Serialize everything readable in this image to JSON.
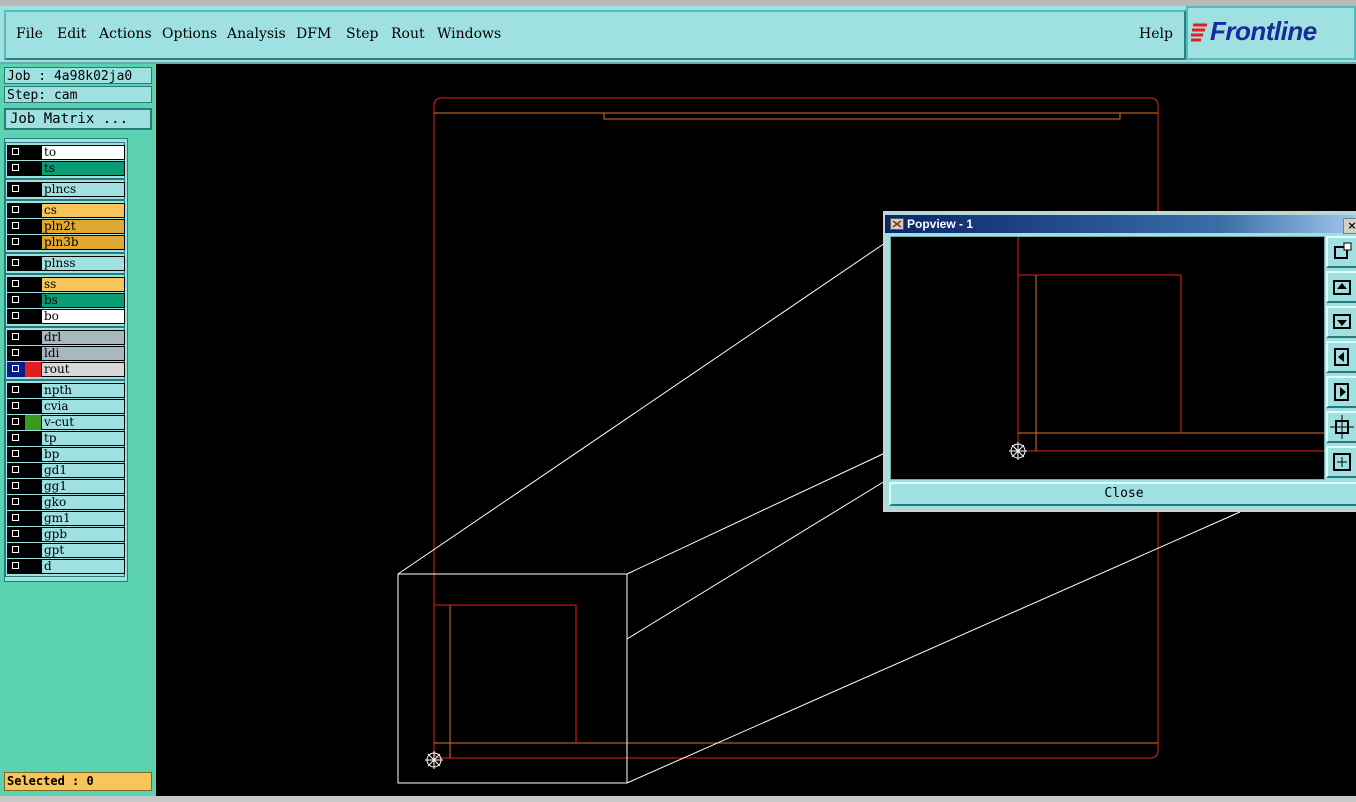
{
  "menubar": {
    "items": [
      "File",
      "Edit",
      "Actions",
      "Options",
      "Analysis",
      "DFM",
      "Step",
      "Rout",
      "Windows"
    ],
    "help": "Help",
    "logo": "Frontline"
  },
  "sidebar": {
    "job": "Job : 4a98k02ja0",
    "step": "Step: cam",
    "job_matrix_button": "Job Matrix ...",
    "layers": [
      {
        "name": "to",
        "color": "#ffffff"
      },
      {
        "name": "ts",
        "color": "#0c9c74"
      },
      {
        "name": "plncs",
        "color": "#9fe0e0"
      },
      {
        "name": "cs",
        "color": "#f7c55a"
      },
      {
        "name": "pln2t",
        "color": "#e0a830"
      },
      {
        "name": "pln3b",
        "color": "#e0a830"
      },
      {
        "name": "plnss",
        "color": "#9fe0e0"
      },
      {
        "name": "ss",
        "color": "#f7c55a"
      },
      {
        "name": "bs",
        "color": "#0c9c74"
      },
      {
        "name": "bo",
        "color": "#ffffff"
      },
      {
        "name": "drl",
        "color": "#a8b8c0"
      },
      {
        "name": "ldi",
        "color": "#a8b8c0"
      },
      {
        "name": "rout",
        "color": "#d8d8d8"
      },
      {
        "name": "npth",
        "color": "#9fe0e0"
      },
      {
        "name": "cvia",
        "color": "#9fe0e0"
      },
      {
        "name": "v-cut",
        "color": "#9fe0e0"
      },
      {
        "name": "tp",
        "color": "#9fe0e0"
      },
      {
        "name": "bp",
        "color": "#9fe0e0"
      },
      {
        "name": "gd1",
        "color": "#9fe0e0"
      },
      {
        "name": "gg1",
        "color": "#9fe0e0"
      },
      {
        "name": "gko",
        "color": "#9fe0e0"
      },
      {
        "name": "gm1",
        "color": "#9fe0e0"
      },
      {
        "name": "gpb",
        "color": "#9fe0e0"
      },
      {
        "name": "gpt",
        "color": "#9fe0e0"
      },
      {
        "name": "d",
        "color": "#9fe0e0"
      }
    ],
    "selected": "Selected : 0"
  },
  "popview": {
    "title": "Popview - 1",
    "close_button": "Close",
    "close_x": "×"
  },
  "colors": {
    "outline": "#e02020",
    "profile": "#e07020",
    "zoom_lines": "#ffffff",
    "accent_teal": "#9fe0e0"
  }
}
